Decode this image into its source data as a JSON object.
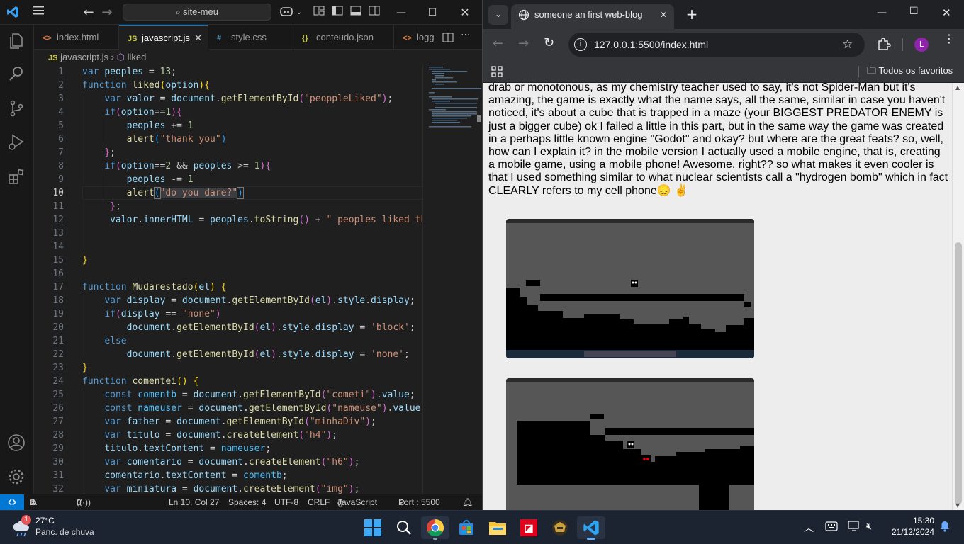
{
  "vscode": {
    "search_text": "site-meu",
    "tabs": [
      {
        "icon": "<>",
        "label": "index.html"
      },
      {
        "icon": "JS",
        "label": "javascript.js"
      },
      {
        "icon": "#",
        "label": "style.css"
      },
      {
        "icon": "{}",
        "label": "conteudo.json"
      },
      {
        "icon": "<>",
        "label": "logg"
      }
    ],
    "breadcrumb": {
      "file": "javascript.js",
      "symbol": "liked"
    },
    "line_numbers": [
      "1",
      "2",
      "3",
      "4",
      "5",
      "6",
      "7",
      "8",
      "9",
      "10",
      "11",
      "12",
      "13",
      "14",
      "15",
      "16",
      "17",
      "18",
      "19",
      "20",
      "21",
      "22",
      "23",
      "24",
      "25",
      "26",
      "27",
      "28",
      "29",
      "30",
      "31",
      "32"
    ],
    "status": {
      "errors": "0",
      "warnings": "0",
      "ports": "0",
      "position": "Ln 10, Col 27",
      "spaces": "Spaces: 4",
      "encoding": "UTF-8",
      "eol": "CRLF",
      "language": "JavaScript",
      "port": "Port : 5500"
    }
  },
  "chrome": {
    "tab_title": "someone an first web-blog",
    "url": "127.0.0.1:5500/index.html",
    "profile_initial": "L",
    "bookmarks_label": "Todos os favoritos",
    "paragraph": "drab or monotonous, as my chemistry teacher used to say, it's not Spider-Man but it's amazing, the game is exactly what the name says, all the same, similar in case you haven't noticed, it's about a cube that is trapped in a maze (your BIGGEST PREDATOR ENEMY is just a bigger cube) ok I failed a little in this part, but in the same way the game was created in a perhaps little known engine \"Godot\" and okay? but where are the great feats? so, well, how can I explain it? in the mobile version I actually used a mobile engine, that is, creating a mobile game, using a mobile phone! Awesome, right?? so what makes it even cooler is that I used something similar to what nuclear scientists call a \"hydrogen bomb\" which in fact CLEARLY refers to my cell phone",
    "emojis": "😞 ✌"
  },
  "taskbar": {
    "weather_temp": "27°C",
    "weather_desc": "Panc. de chuva",
    "weather_badge": "1",
    "time": "15:30",
    "date": "21/12/2024"
  }
}
